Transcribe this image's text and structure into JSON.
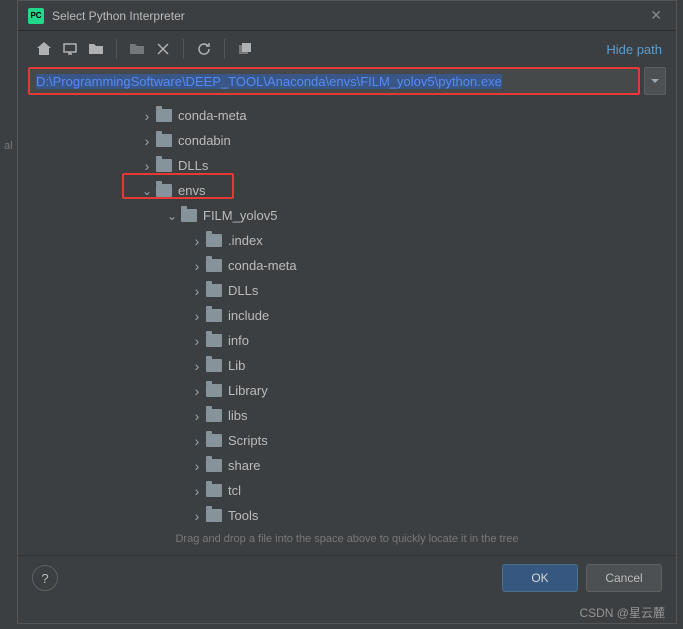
{
  "dialog": {
    "title": "Select Python Interpreter",
    "path": "D:\\ProgrammingSoftware\\DEEP_TOOL\\Anaconda\\envs\\FILM_yolov5\\python.exe",
    "hide_path": "Hide path",
    "hint": "Drag and drop a file into the space above to quickly locate it in the tree"
  },
  "toolbar": {
    "home": "home-icon",
    "desktop": "desktop-icon",
    "project": "project-icon",
    "newfolder": "new-folder-icon",
    "delete": "delete-icon",
    "refresh": "refresh-icon",
    "showhidden": "show-hidden-icon"
  },
  "tree": [
    {
      "label": "conda-meta",
      "indent": 120,
      "arrow": "collapsed"
    },
    {
      "label": "condabin",
      "indent": 120,
      "arrow": "collapsed"
    },
    {
      "label": "DLLs",
      "indent": 120,
      "arrow": "collapsed"
    },
    {
      "label": "envs",
      "indent": 120,
      "arrow": "expanded"
    },
    {
      "label": "FILM_yolov5",
      "indent": 145,
      "arrow": "expanded"
    },
    {
      "label": ".index",
      "indent": 170,
      "arrow": "collapsed"
    },
    {
      "label": "conda-meta",
      "indent": 170,
      "arrow": "collapsed"
    },
    {
      "label": "DLLs",
      "indent": 170,
      "arrow": "collapsed"
    },
    {
      "label": "include",
      "indent": 170,
      "arrow": "collapsed"
    },
    {
      "label": "info",
      "indent": 170,
      "arrow": "collapsed"
    },
    {
      "label": "Lib",
      "indent": 170,
      "arrow": "collapsed"
    },
    {
      "label": "Library",
      "indent": 170,
      "arrow": "collapsed"
    },
    {
      "label": "libs",
      "indent": 170,
      "arrow": "collapsed"
    },
    {
      "label": "Scripts",
      "indent": 170,
      "arrow": "collapsed"
    },
    {
      "label": "share",
      "indent": 170,
      "arrow": "collapsed"
    },
    {
      "label": "tcl",
      "indent": 170,
      "arrow": "collapsed"
    },
    {
      "label": "Tools",
      "indent": 170,
      "arrow": "collapsed"
    }
  ],
  "buttons": {
    "ok": "OK",
    "cancel": "Cancel",
    "help": "?"
  },
  "watermark": "CSDN @星云麓"
}
